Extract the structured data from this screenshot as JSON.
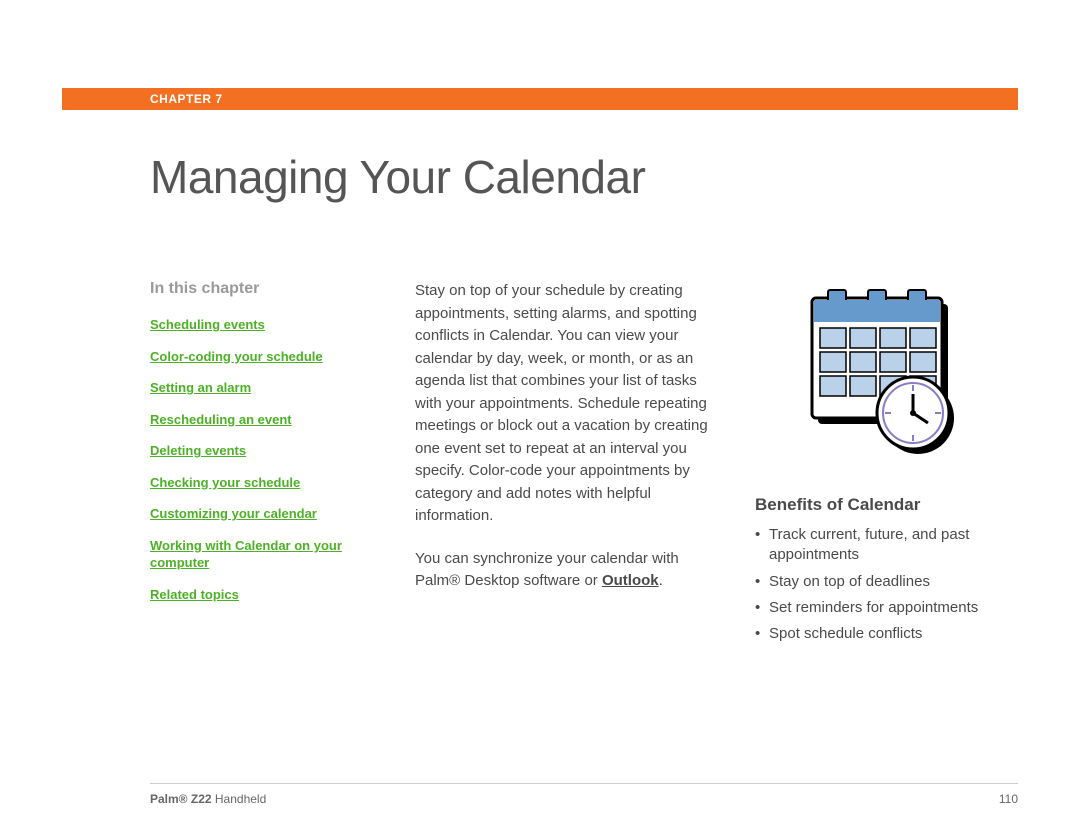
{
  "header": {
    "chapter_label": "CHAPTER 7"
  },
  "title": "Managing Your Calendar",
  "sidebar": {
    "heading": "In this chapter",
    "links": [
      "Scheduling events",
      "Color-coding your schedule",
      "Setting an alarm",
      "Rescheduling an event",
      "Deleting events",
      "Checking your schedule",
      "Customizing your calendar",
      "Working with Calendar on your computer",
      "Related topics"
    ]
  },
  "main": {
    "para1": "Stay on top of your schedule by creating appointments, setting alarms, and spotting conflicts in Calendar. You can view your calendar by day, week, or month, or as an agenda list that combines your list of tasks with your appointments. Schedule repeating meetings or block out a vacation by creating one event set to repeat at an interval you specify. Color-code your appointments by category and add notes with helpful information.",
    "para2_pre": "You can synchronize your calendar with Palm® Desktop software or ",
    "para2_link": "Outlook",
    "para2_post": "."
  },
  "benefits": {
    "heading": "Benefits of Calendar",
    "items": [
      "Track current, future, and past appointments",
      "Stay on top of deadlines",
      "Set reminders for appointments",
      "Spot schedule conflicts"
    ]
  },
  "footer": {
    "product_strong": "Palm® Z22",
    "product_rest": " Handheld",
    "page_number": "110"
  }
}
